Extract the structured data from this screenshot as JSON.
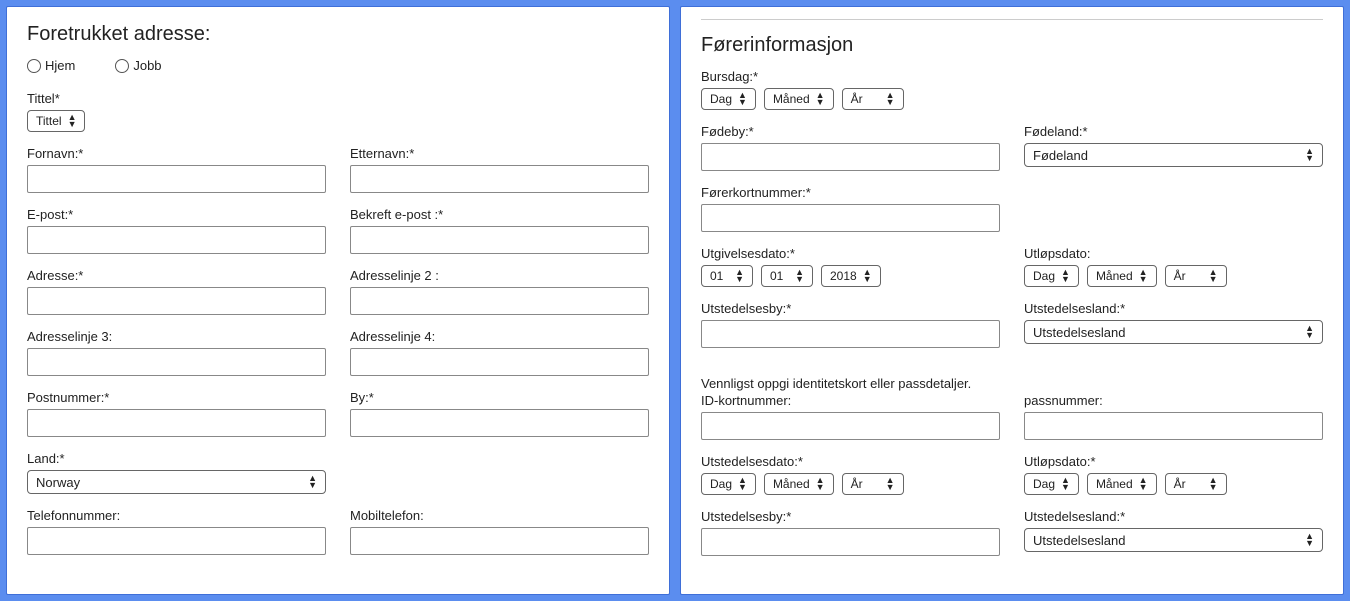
{
  "left": {
    "heading": "Foretrukket adresse:",
    "radios": {
      "home": "Hjem",
      "work": "Jobb"
    },
    "title_label": "Tittel*",
    "title_select": "Tittel",
    "firstname_label": "Fornavn:*",
    "lastname_label": "Etternavn:*",
    "email_label": "E-post:*",
    "confirm_email_label": "Bekreft e-post :*",
    "address_label": "Adresse:*",
    "address2_label": "Adresselinje 2 :",
    "address3_label": "Adresselinje 3:",
    "address4_label": "Adresselinje 4:",
    "postcode_label": "Postnummer:*",
    "city_label": "By:*",
    "country_label": "Land:*",
    "country_value": "Norway",
    "phone_label": "Telefonnummer:",
    "mobile_label": "Mobiltelefon:"
  },
  "right": {
    "heading": "Førerinformasjon",
    "birthday_label": "Bursdag:*",
    "day": "Dag",
    "month": "Måned",
    "year": "År",
    "birth_city_label": "Fødeby:*",
    "birth_country_label": "Fødeland:*",
    "birth_country_value": "Fødeland",
    "license_no_label": "Førerkortnummer:*",
    "issue_date_label": "Utgivelsesdato:*",
    "issue_day": "01",
    "issue_month": "01",
    "issue_year": "2018",
    "expiry_date_label": "Utløpsdato:",
    "issue_city_label": "Utstedelsesby:*",
    "issue_country_label": "Utstedelsesland:*",
    "issue_country_value": "Utstedelsesland",
    "id_intro": "Vennligst oppgi identitetskort eller passdetaljer.",
    "id_number_label": "ID-kortnummer:",
    "passport_label": "passnummer:",
    "id_issue_date_label": "Utstedelsesdato:*",
    "id_expiry_date_label": "Utløpsdato:*",
    "id_issue_city_label": "Utstedelsesby:*",
    "id_issue_country_label": "Utstedelsesland:*",
    "id_issue_country_value": "Utstedelsesland"
  }
}
